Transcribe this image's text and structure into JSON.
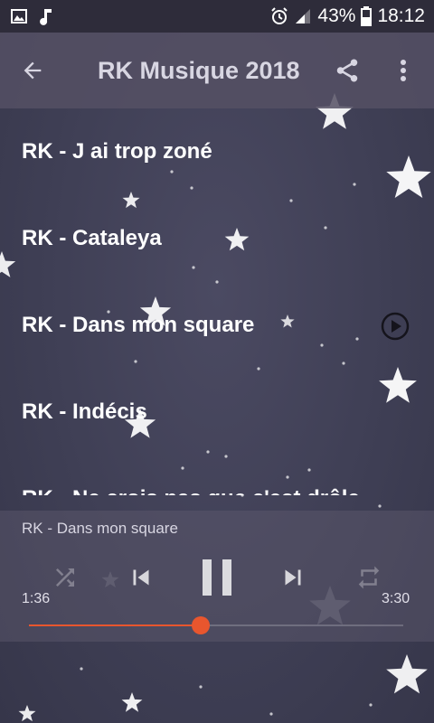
{
  "status_bar": {
    "battery": "43%",
    "time": "18:12"
  },
  "app_bar": {
    "title": "RK Musique 2018"
  },
  "songs": [
    {
      "title": "RK - J ai trop zoné"
    },
    {
      "title": "RK - Cataleya"
    },
    {
      "title": "RK - Dans mon square"
    },
    {
      "title": "RK - Indécis"
    },
    {
      "title": "RK - Ne crois pas que c'est drôle"
    }
  ],
  "player": {
    "now_playing": "RK - Dans mon square",
    "current_time": "1:36",
    "total_time": "3:30",
    "progress": 0.46
  },
  "colors": {
    "accent": "#e8562e",
    "status_bar": "#2e2c3a"
  }
}
